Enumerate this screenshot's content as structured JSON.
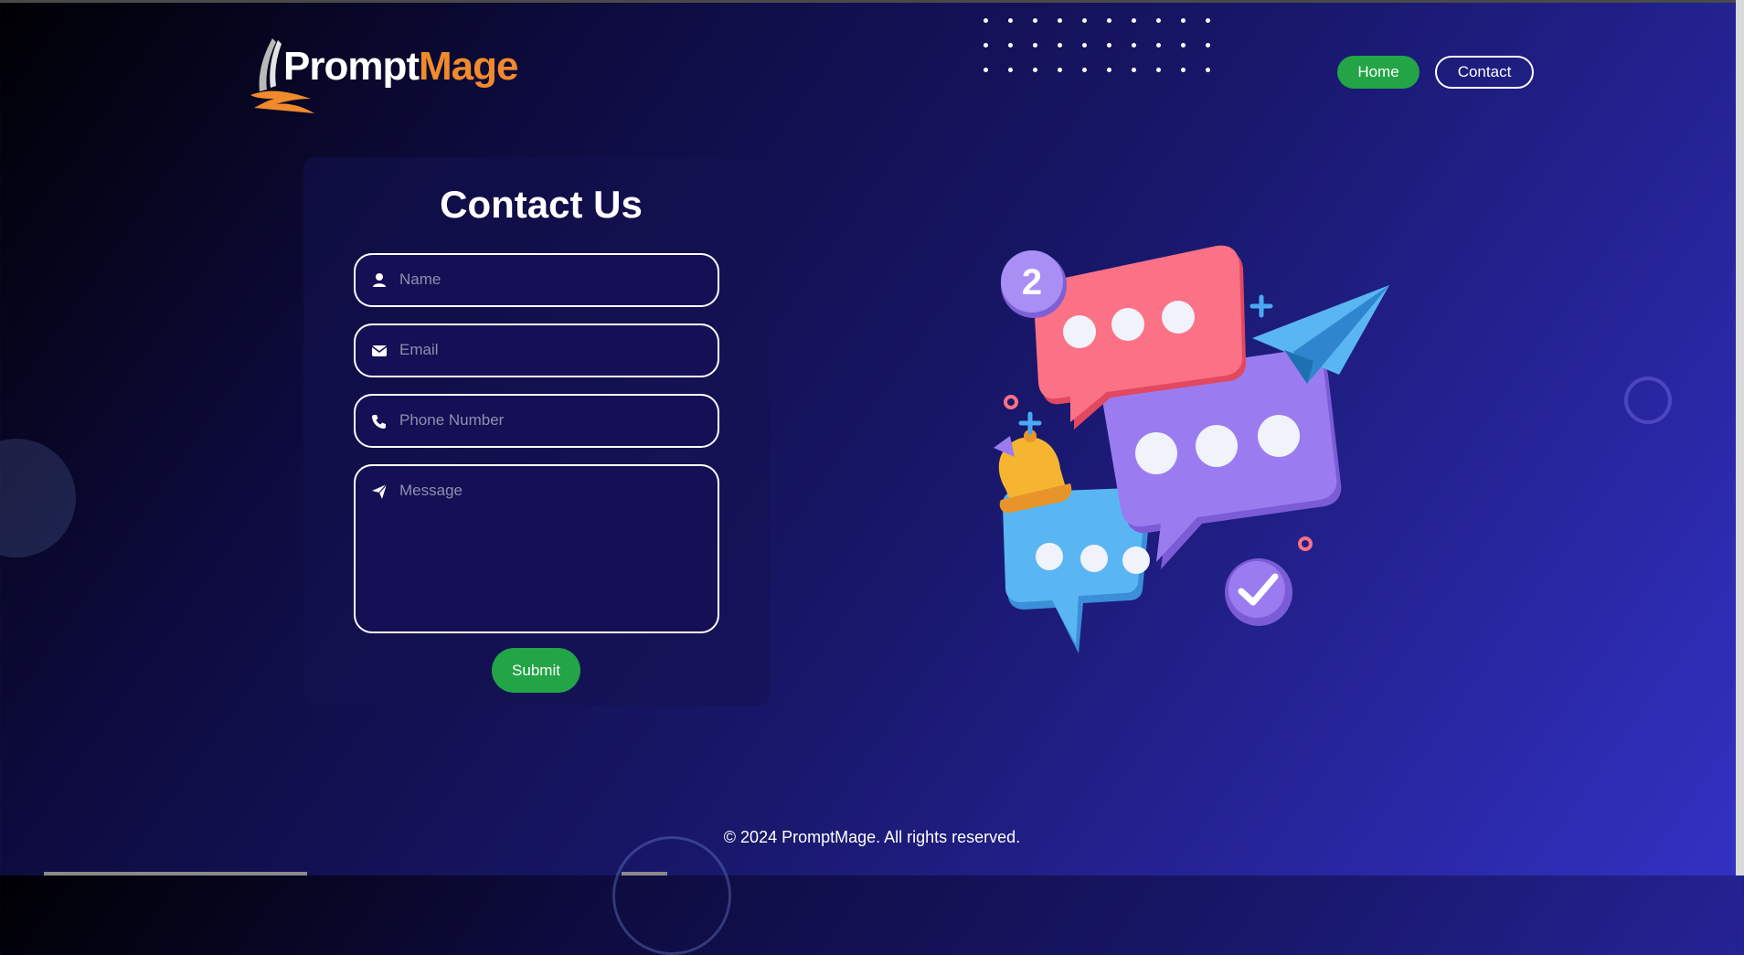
{
  "logo": {
    "part1": "Prompt",
    "part2": "Mage"
  },
  "nav": {
    "home_label": "Home",
    "contact_label": "Contact"
  },
  "form": {
    "title": "Contact Us",
    "name_placeholder": "Name",
    "email_placeholder": "Email",
    "phone_placeholder": "Phone Number",
    "message_placeholder": "Message",
    "submit_label": "Submit"
  },
  "illustration": {
    "badge_number": "2"
  },
  "footer": {
    "text": "© 2024 PromptMage. All rights reserved."
  },
  "colors": {
    "accent_green": "#22a447",
    "logo_orange": "#f08a2c",
    "bubble_pink": "#fb7185",
    "bubble_purple": "#9b7cf0",
    "bubble_blue": "#5ab6f2"
  },
  "icons": {
    "name": "user-icon",
    "email": "envelope-icon",
    "phone": "phone-icon",
    "message": "paper-plane-icon"
  }
}
